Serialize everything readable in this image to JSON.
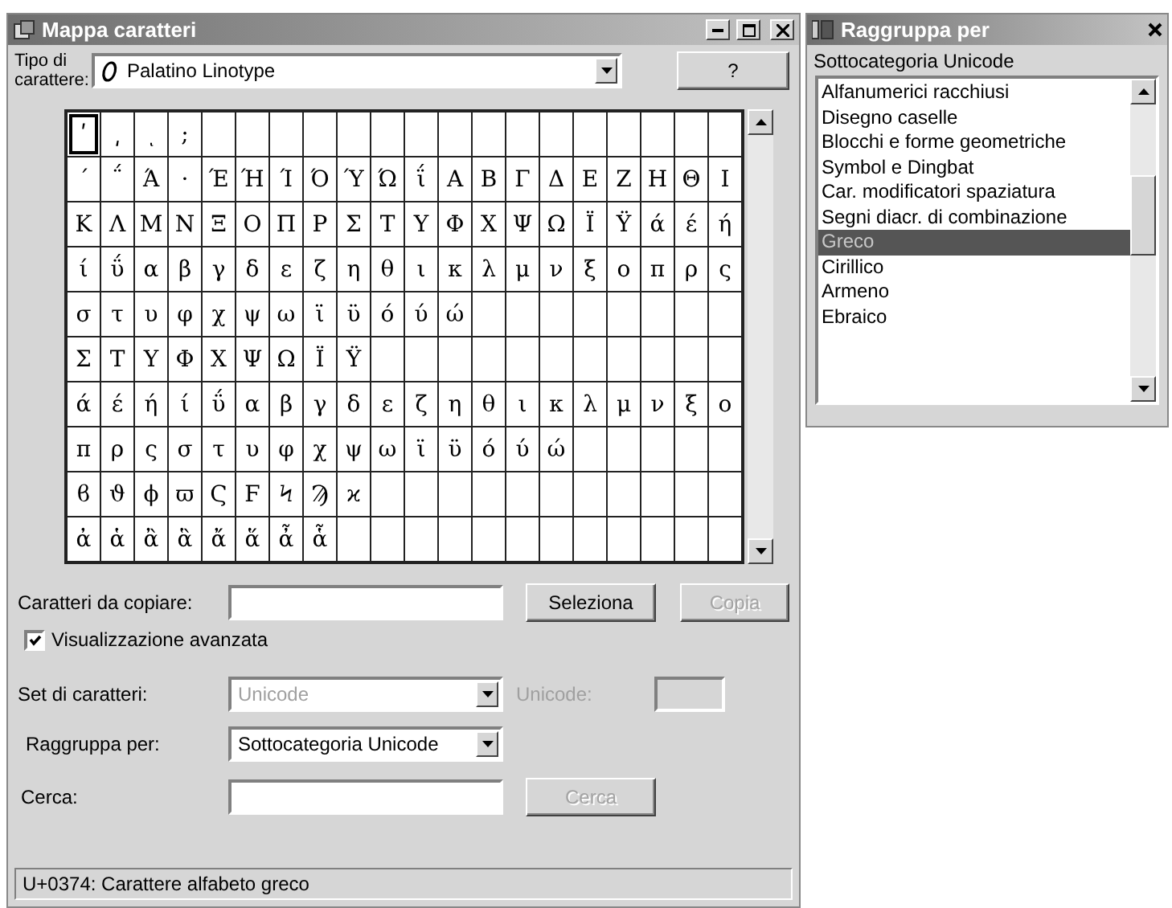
{
  "window": {
    "title": "Mappa caratteri"
  },
  "font": {
    "label": "Tipo di carattere:",
    "value": "Palatino Linotype"
  },
  "help_button": {
    "label": "?"
  },
  "grid": {
    "rows": [
      [
        {
          "char": "ʹ",
          "selected": true
        },
        {
          "char": "͵",
          "selected": false
        },
        {
          "char": "ͺ",
          "selected": false
        },
        {
          "char": ";",
          "selected": false
        }
      ],
      [
        {
          "char": "΄",
          "selected": false
        },
        {
          "char": "΅",
          "selected": false
        },
        {
          "char": "Ά",
          "selected": false
        },
        {
          "char": "·",
          "selected": false
        },
        {
          "char": "Έ",
          "selected": false
        },
        {
          "char": "Ή",
          "selected": false
        },
        {
          "char": "Ί",
          "selected": false
        },
        {
          "char": "Ό",
          "selected": false
        },
        {
          "char": "Ύ",
          "selected": false
        },
        {
          "char": "Ώ",
          "selected": false
        },
        {
          "char": "ΐ",
          "selected": false
        },
        {
          "char": "Α",
          "selected": false
        },
        {
          "char": "Β",
          "selected": false
        },
        {
          "char": "Γ",
          "selected": false
        },
        {
          "char": "Δ",
          "selected": false
        },
        {
          "char": "Ε",
          "selected": false
        },
        {
          "char": "Ζ",
          "selected": false
        },
        {
          "char": "Η",
          "selected": false
        },
        {
          "char": "Θ",
          "selected": false
        },
        {
          "char": "Ι",
          "selected": false
        }
      ],
      [
        {
          "char": "Κ",
          "selected": false
        },
        {
          "char": "Λ",
          "selected": false
        },
        {
          "char": "Μ",
          "selected": false
        },
        {
          "char": "Ν",
          "selected": false
        },
        {
          "char": "Ξ",
          "selected": false
        },
        {
          "char": "Ο",
          "selected": false
        },
        {
          "char": "Π",
          "selected": false
        },
        {
          "char": "Ρ",
          "selected": false
        },
        {
          "char": "Σ",
          "selected": false
        },
        {
          "char": "Τ",
          "selected": false
        },
        {
          "char": "Υ",
          "selected": false
        },
        {
          "char": "Φ",
          "selected": false
        },
        {
          "char": "Χ",
          "selected": false
        },
        {
          "char": "Ψ",
          "selected": false
        },
        {
          "char": "Ω",
          "selected": false
        },
        {
          "char": "Ϊ",
          "selected": false
        },
        {
          "char": "Ϋ",
          "selected": false
        },
        {
          "char": "ά",
          "selected": false
        },
        {
          "char": "έ",
          "selected": false
        },
        {
          "char": "ή",
          "selected": false
        }
      ],
      [
        {
          "char": "ί",
          "selected": false
        },
        {
          "char": "ΰ",
          "selected": false
        },
        {
          "char": "α",
          "selected": false
        },
        {
          "char": "β",
          "selected": false
        },
        {
          "char": "γ",
          "selected": false
        },
        {
          "char": "δ",
          "selected": false
        },
        {
          "char": "ε",
          "selected": false
        },
        {
          "char": "ζ",
          "selected": false
        },
        {
          "char": "η",
          "selected": false
        },
        {
          "char": "θ",
          "selected": false
        },
        {
          "char": "ι",
          "selected": false
        },
        {
          "char": "κ",
          "selected": false
        },
        {
          "char": "λ",
          "selected": false
        },
        {
          "char": "μ",
          "selected": false
        },
        {
          "char": "ν",
          "selected": false
        },
        {
          "char": "ξ",
          "selected": false
        },
        {
          "char": "ο",
          "selected": false
        },
        {
          "char": "π",
          "selected": false
        },
        {
          "char": "ρ",
          "selected": false
        },
        {
          "char": "ς",
          "selected": false
        }
      ],
      [
        {
          "char": "σ",
          "selected": false
        },
        {
          "char": "τ",
          "selected": false
        },
        {
          "char": "υ",
          "selected": false
        },
        {
          "char": "φ",
          "selected": false
        },
        {
          "char": "χ",
          "selected": false
        },
        {
          "char": "ψ",
          "selected": false
        },
        {
          "char": "ω",
          "selected": false
        },
        {
          "char": "ϊ",
          "selected": false
        },
        {
          "char": "ϋ",
          "selected": false
        },
        {
          "char": "ό",
          "selected": false
        },
        {
          "char": "ύ",
          "selected": false
        },
        {
          "char": "ώ",
          "selected": false
        }
      ],
      [
        {
          "char": "Σ",
          "selected": false
        },
        {
          "char": "Τ",
          "selected": false
        },
        {
          "char": "Υ",
          "selected": false
        },
        {
          "char": "Φ",
          "selected": false
        },
        {
          "char": "Χ",
          "selected": false
        },
        {
          "char": "Ψ",
          "selected": false
        },
        {
          "char": "Ω",
          "selected": false
        },
        {
          "char": "Ϊ",
          "selected": false
        },
        {
          "char": "Ϋ",
          "selected": false
        }
      ],
      [
        {
          "char": "ά",
          "selected": false
        },
        {
          "char": "έ",
          "selected": false
        },
        {
          "char": "ή",
          "selected": false
        },
        {
          "char": "ί",
          "selected": false
        },
        {
          "char": "ΰ",
          "selected": false
        },
        {
          "char": "α",
          "selected": false
        },
        {
          "char": "β",
          "selected": false
        },
        {
          "char": "γ",
          "selected": false
        },
        {
          "char": "δ",
          "selected": false
        },
        {
          "char": "ε",
          "selected": false
        },
        {
          "char": "ζ",
          "selected": false
        },
        {
          "char": "η",
          "selected": false
        },
        {
          "char": "θ",
          "selected": false
        },
        {
          "char": "ι",
          "selected": false
        },
        {
          "char": "κ",
          "selected": false
        },
        {
          "char": "λ",
          "selected": false
        },
        {
          "char": "μ",
          "selected": false
        },
        {
          "char": "ν",
          "selected": false
        },
        {
          "char": "ξ",
          "selected": false
        },
        {
          "char": "ο",
          "selected": false
        }
      ],
      [
        {
          "char": "π",
          "selected": false
        },
        {
          "char": "ρ",
          "selected": false
        },
        {
          "char": "ς",
          "selected": false
        },
        {
          "char": "σ",
          "selected": false
        },
        {
          "char": "τ",
          "selected": false
        },
        {
          "char": "υ",
          "selected": false
        },
        {
          "char": "φ",
          "selected": false
        },
        {
          "char": "χ",
          "selected": false
        },
        {
          "char": "ψ",
          "selected": false
        },
        {
          "char": "ω",
          "selected": false
        },
        {
          "char": "ϊ",
          "selected": false
        },
        {
          "char": "ϋ",
          "selected": false
        },
        {
          "char": "ό",
          "selected": false
        },
        {
          "char": "ύ",
          "selected": false
        },
        {
          "char": "ώ",
          "selected": false
        }
      ],
      [
        {
          "char": "ϐ",
          "selected": false
        },
        {
          "char": "ϑ",
          "selected": false
        },
        {
          "char": "ϕ",
          "selected": false
        },
        {
          "char": "ϖ",
          "selected": false
        },
        {
          "char": "Ϛ",
          "selected": false
        },
        {
          "char": "Ϝ",
          "selected": false
        },
        {
          "char": "Ϟ",
          "selected": false
        },
        {
          "char": "Ϡ",
          "selected": false
        },
        {
          "char": "ϰ",
          "selected": false
        }
      ],
      [
        {
          "char": "ἀ",
          "selected": false
        },
        {
          "char": "ἁ",
          "selected": false
        },
        {
          "char": "ἂ",
          "selected": false
        },
        {
          "char": "ἃ",
          "selected": false
        },
        {
          "char": "ἄ",
          "selected": false
        },
        {
          "char": "ἅ",
          "selected": false
        },
        {
          "char": "ἆ",
          "selected": false
        },
        {
          "char": "ἇ",
          "selected": false
        }
      ]
    ]
  },
  "copy": {
    "label": "Caratteri da copiare:"
  },
  "select_button": {
    "label": "Seleziona",
    "disabled": false
  },
  "copy_button": {
    "label": "Copia",
    "disabled": true
  },
  "advanced_view": {
    "label": "Visualizzazione avanzata",
    "checked": true
  },
  "charset": {
    "label": "Set di caratteri:",
    "value": "Unicode",
    "disabled": true
  },
  "unicode": {
    "label": "Unicode:",
    "disabled": true
  },
  "group_by": {
    "label": "Raggruppa per:",
    "value": "Sottocategoria Unicode"
  },
  "search": {
    "label": "Cerca:"
  },
  "search_button": {
    "label": "Cerca",
    "disabled": true
  },
  "status_bar": "U+0374: Carattere alfabeto greco",
  "group_panel": {
    "title": "Raggruppa per",
    "heading": "Sottocategoria Unicode",
    "items": [
      {
        "label": "Alfanumerici racchiusi",
        "selected": false
      },
      {
        "label": "Disegno caselle",
        "selected": false
      },
      {
        "label": "Blocchi e forme geometriche",
        "selected": false
      },
      {
        "label": "Symbol e Dingbat",
        "selected": false
      },
      {
        "label": "Car. modificatori spaziatura",
        "selected": false
      },
      {
        "label": "Segni diacr. di combinazione",
        "selected": false
      },
      {
        "label": "Greco",
        "selected": true
      },
      {
        "label": "Cirillico",
        "selected": false
      },
      {
        "label": "Armeno",
        "selected": false
      },
      {
        "label": "Ebraico",
        "selected": false
      }
    ]
  }
}
